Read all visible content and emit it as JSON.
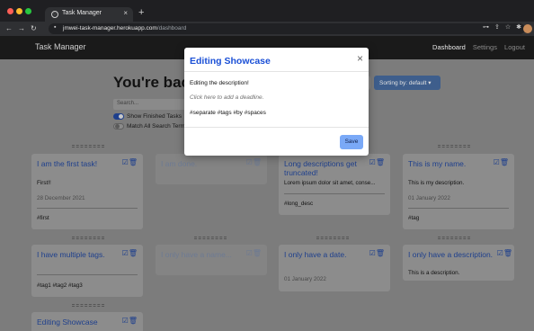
{
  "browser": {
    "tab_title": "Task Manager",
    "tab_close": "×",
    "new_tab": "+",
    "url_host": "jmwei-task-manager.herokuapp.com",
    "url_path": "/dashboard"
  },
  "navbar": {
    "brand": "Task Manager",
    "links": [
      "Dashboard",
      "Settings",
      "Logout"
    ]
  },
  "page": {
    "welcome": "You're back",
    "search_placeholder": "Search...",
    "show_finished": "Show Finished Tasks",
    "match_all": "Match All Search Terms",
    "sort_button": "Sorting by: default ▾"
  },
  "cards": [
    {
      "title": "I am the first task!",
      "description": "First!!",
      "date": "28 December 2021",
      "tags": "#first",
      "done": false
    },
    {
      "title": "I am done.",
      "description": "",
      "date": "",
      "tags": "",
      "done": true
    },
    {
      "title": "Long descriptions get truncated!",
      "description": "Lorem ipsum dolor sit amet, conse...",
      "date": "",
      "tags": "#long_desc",
      "done": false
    },
    {
      "title": "This is my name.",
      "description": "This is my description.",
      "date": "01 January 2022",
      "tags": "#tag",
      "done": false
    },
    {
      "title": "I have multiple tags.",
      "description": "",
      "date": "",
      "tags": "#tag1 #tag2 #tag3",
      "done": false
    },
    {
      "title": "I only have a name...",
      "description": "",
      "date": "",
      "tags": "",
      "done": true
    },
    {
      "title": "I only have a date.",
      "description": "",
      "date": "01 January 2022",
      "tags": "",
      "done": false
    },
    {
      "title": "I only have a description.",
      "description": "This is a description.",
      "date": "",
      "tags": "",
      "done": false
    },
    {
      "title": "Editing Showcase",
      "description": "",
      "date": "",
      "tags": "",
      "done": false
    }
  ],
  "modal": {
    "title": "Editing Showcase",
    "close": "×",
    "description": "Editing the description!",
    "deadline_placeholder": "Click here to add a deadline.",
    "tags": "#separate #tags #by #spaces",
    "save": "Save"
  },
  "icons": {
    "edit": "edit-icon",
    "delete": "trash-icon"
  },
  "colors": {
    "accent": "#1a4fd6",
    "save_button": "#7aa9f7",
    "navbar": "#1a1a1a"
  }
}
